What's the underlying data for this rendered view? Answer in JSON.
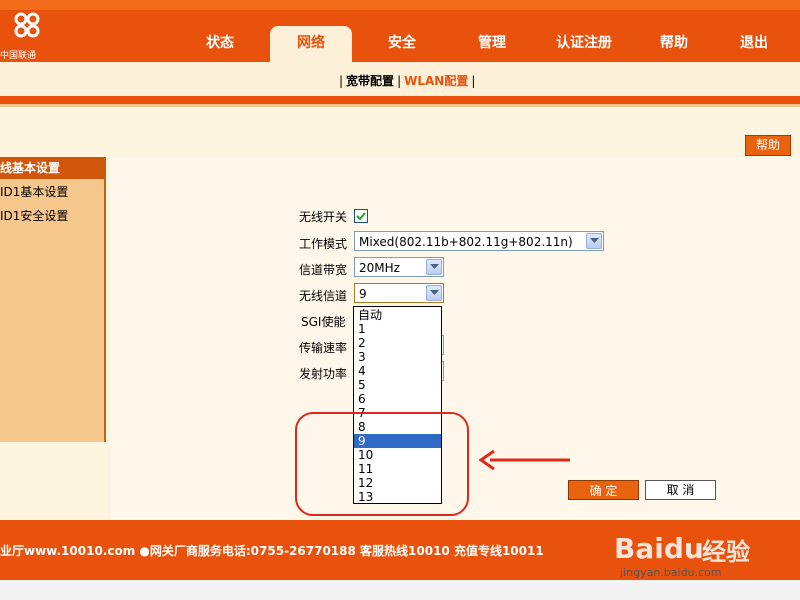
{
  "brand": {
    "name": "中国联通"
  },
  "nav": {
    "items": [
      "状态",
      "网络",
      "安全",
      "管理",
      "认证注册",
      "帮助",
      "退出"
    ],
    "active": "网络"
  },
  "subnav": {
    "items": [
      "宽带配置",
      "WLAN配置"
    ],
    "active": "WLAN配置"
  },
  "help": "帮助",
  "sidebar": {
    "items": [
      "线基本设置",
      "ID1基本设置",
      "ID1安全设置"
    ],
    "active": "线基本设置"
  },
  "form": {
    "wireless_switch": {
      "label": "无线开关",
      "checked": true
    },
    "work_mode": {
      "label": "工作模式",
      "value": "Mixed(802.11b+802.11g+802.11n)"
    },
    "bandwidth": {
      "label": "信道带宽",
      "value": "20MHz"
    },
    "channel": {
      "label": "无线信道",
      "value": "9"
    },
    "sgi": {
      "label": "SGI使能"
    },
    "rate": {
      "label": "传输速率"
    },
    "power": {
      "label": "发射功率"
    }
  },
  "channel_options": [
    "自动",
    "1",
    "2",
    "3",
    "4",
    "5",
    "6",
    "7",
    "8",
    "9",
    "10",
    "11",
    "12",
    "13"
  ],
  "channel_selected": "9",
  "buttons": {
    "ok": "确 定",
    "cancel": "取 消"
  },
  "footer": {
    "text": "业厅www.10010.com ●网关厂商服务电话:0755-26770188 客服热线10010 充值专线10011"
  },
  "watermark": {
    "brand": "Baidu",
    "product": "经验",
    "url": "jingyan.baidu.com"
  },
  "colors": {
    "brand_orange": "#e8520c",
    "highlight_blue": "#316ac5",
    "annotation_red": "#e0271d"
  }
}
